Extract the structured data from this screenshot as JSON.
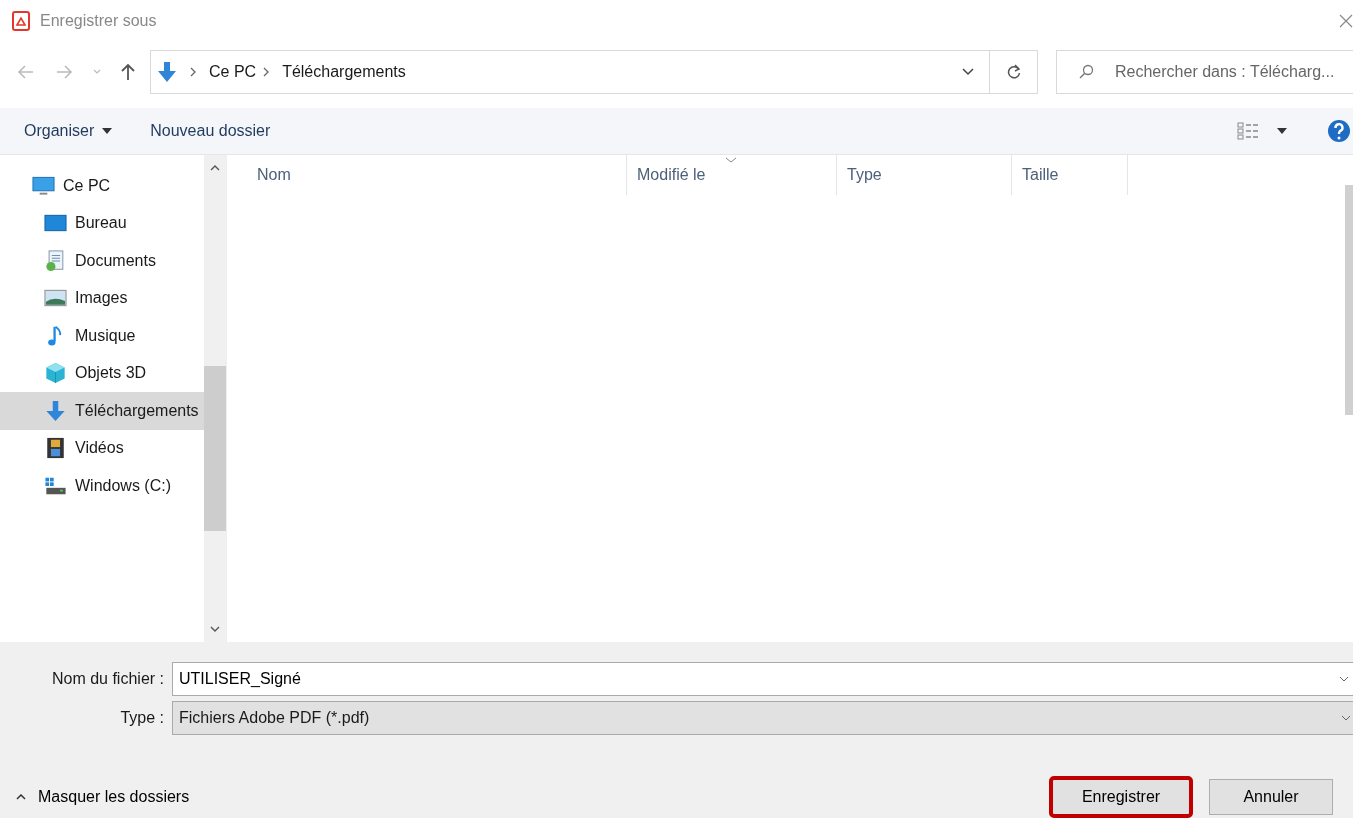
{
  "window": {
    "title": "Enregistrer sous"
  },
  "address_bar": {
    "path": [
      "Ce PC",
      "Téléchargements"
    ]
  },
  "search": {
    "placeholder": "Rechercher dans : Télécharg..."
  },
  "toolbar": {
    "organize": "Organiser",
    "new_folder": "Nouveau dossier"
  },
  "sidebar": {
    "items": [
      {
        "label": "Ce PC",
        "kind": "pc",
        "selected": false,
        "children": [
          {
            "label": "Bureau",
            "kind": "desktop",
            "selected": false
          },
          {
            "label": "Documents",
            "kind": "documents",
            "selected": false
          },
          {
            "label": "Images",
            "kind": "images",
            "selected": false
          },
          {
            "label": "Musique",
            "kind": "music",
            "selected": false
          },
          {
            "label": "Objets 3D",
            "kind": "cube",
            "selected": false
          },
          {
            "label": "Téléchargements",
            "kind": "download",
            "selected": true
          },
          {
            "label": "Vidéos",
            "kind": "videos",
            "selected": false
          },
          {
            "label": "Windows  (C:)",
            "kind": "drive",
            "selected": false
          }
        ]
      }
    ]
  },
  "table": {
    "columns": [
      {
        "label": "Nom",
        "sorted": false
      },
      {
        "label": "Modifié le",
        "sorted": true
      },
      {
        "label": "Type",
        "sorted": false
      },
      {
        "label": "Taille",
        "sorted": false
      }
    ]
  },
  "form": {
    "filename_label": "Nom du fichier :",
    "filename": "UTILISER_Signé",
    "type_label": "Type :",
    "type": "Fichiers Adobe PDF (*.pdf)"
  },
  "hide_folders": "Masquer les dossiers",
  "buttons": [
    {
      "label": "Enregistrer",
      "highlighted": true
    },
    {
      "label": "Annuler",
      "highlighted": false
    }
  ]
}
